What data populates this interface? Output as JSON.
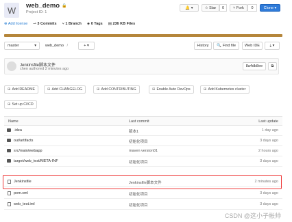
{
  "project": {
    "avatar_letter": "W",
    "name": "web_demo",
    "id_label": "Project ID: 1"
  },
  "header_buttons": {
    "notify": "🔔 ▾",
    "star": "☆ Star",
    "star_count": "0",
    "fork": "⑂ Fork",
    "fork_count": "0",
    "clone": "Clone ▾"
  },
  "stats": {
    "add_license": "Add license",
    "commits": "3 Commits",
    "branch": "1 Branch",
    "tags": "0 Tags",
    "files": "236 KB Files"
  },
  "toolbar": {
    "branch": "master",
    "breadcrumb": "web_demo",
    "sep": "/",
    "add": "+ ▾",
    "history": "History",
    "find_file": "Find file",
    "web_ide": "Web IDE",
    "download": "⤓ ▾"
  },
  "last_commit": {
    "message": "Jenkinsfile脚本文件",
    "meta": "chen authored 2 minutes ago",
    "sha": "8a4db8ee",
    "copy": "⧉"
  },
  "add_buttons": [
    "Add README",
    "Add CHANGELOG",
    "Add CONTRIBUTING",
    "Enable Auto DevOps",
    "Add Kubernetes cluster",
    "Set up CI/CD"
  ],
  "table": {
    "headers": {
      "name": "Name",
      "last_commit": "Last commit",
      "last_update": "Last update"
    },
    "rows": [
      {
        "name": ".idea",
        "type": "folder",
        "commit": "版本1",
        "update": "1 day ago"
      },
      {
        "name": "out/artifacts",
        "type": "folder",
        "commit": "初始化项目",
        "update": "3 days ago"
      },
      {
        "name": "src/main/webapp",
        "type": "folder",
        "commit": "maven version01",
        "update": "2 hours ago"
      },
      {
        "name": "target/web_test/META-INF",
        "type": "folder",
        "commit": "初始化项目",
        "update": "3 days ago"
      },
      {
        "name": "Jenkinsfile",
        "type": "file",
        "commit": "Jenkinsfile脚本文件",
        "update": "2 minutes ago"
      },
      {
        "name": "pom.xml",
        "type": "file",
        "commit": "初始化项目",
        "update": "3 days ago"
      },
      {
        "name": "web_test.iml",
        "type": "file",
        "commit": "初始化项目",
        "update": "3 days ago"
      }
    ]
  },
  "watermark": "CSDN @这小子帐帅",
  "colors": {
    "accent": "#2f7bd9",
    "progress": "#b5863b",
    "highlight": "#e33333"
  }
}
